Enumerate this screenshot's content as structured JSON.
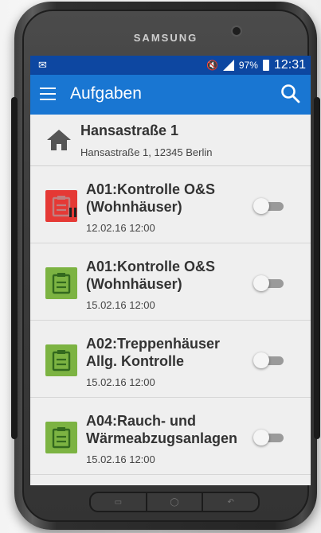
{
  "device": {
    "brand": "SAMSUNG"
  },
  "status_bar": {
    "battery": "97%",
    "time": "12:31"
  },
  "app_bar": {
    "title": "Aufgaben"
  },
  "address": {
    "title": "Hansastraße 1",
    "subtitle": "Hansastraße 1, 12345 Berlin"
  },
  "tasks": [
    {
      "title": "A01:Kontrolle O&S (Wohnhäuser)",
      "date": "12.02.16 12:00",
      "status": "paused",
      "color": "#e53935",
      "enabled": false
    },
    {
      "title": "A01:Kontrolle O&S (Wohnhäuser)",
      "date": "15.02.16 12:00",
      "status": "open",
      "color": "#7cb342",
      "enabled": false
    },
    {
      "title": "A02:Treppenhäuser Allg. Kontrolle",
      "date": "15.02.16 12:00",
      "status": "open",
      "color": "#7cb342",
      "enabled": false
    },
    {
      "title": "A04:Rauch- und Wärmeabzugsanlagen",
      "date": "15.02.16 12:00",
      "status": "open",
      "color": "#7cb342",
      "enabled": false
    }
  ]
}
